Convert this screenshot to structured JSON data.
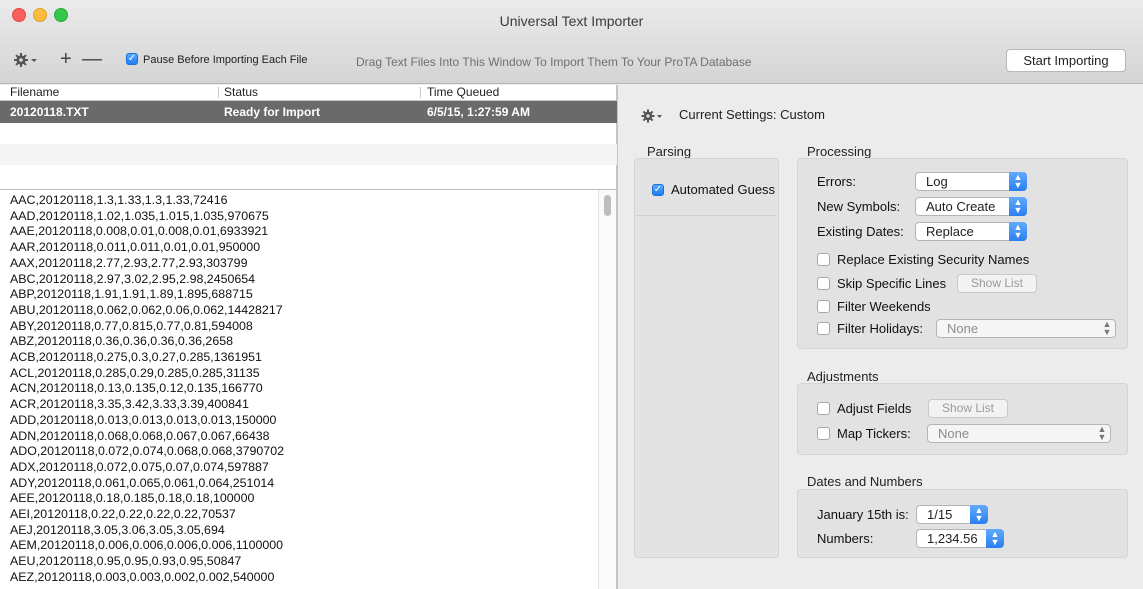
{
  "window": {
    "title": "Universal Text Importer"
  },
  "toolbar": {
    "gear_icon": "gear-icon",
    "add_label": "+",
    "remove_label": "—",
    "pause_label": "Pause Before Importing Each File",
    "pause_checked": true,
    "drag_hint": "Drag Text Files Into This Window To Import Them To Your ProTA Database",
    "start_label": "Start Importing"
  },
  "file_table": {
    "columns": [
      "Filename",
      "Status",
      "Time Queued"
    ],
    "rows": [
      {
        "filename": "20120118.TXT",
        "status": "Ready for Import",
        "time": "6/5/15, 1:27:59 AM",
        "selected": true
      }
    ]
  },
  "text_content": [
    "AAC,20120118,1.3,1.33,1.3,1.33,72416",
    "AAD,20120118,1.02,1.035,1.015,1.035,970675",
    "AAE,20120118,0.008,0.01,0.008,0.01,6933921",
    "AAR,20120118,0.011,0.011,0.01,0.01,950000",
    "AAX,20120118,2.77,2.93,2.77,2.93,303799",
    "ABC,20120118,2.97,3.02,2.95,2.98,2450654",
    "ABP,20120118,1.91,1.91,1.89,1.895,688715",
    "ABU,20120118,0.062,0.062,0.06,0.062,14428217",
    "ABY,20120118,0.77,0.815,0.77,0.81,594008",
    "ABZ,20120118,0.36,0.36,0.36,0.36,2658",
    "ACB,20120118,0.275,0.3,0.27,0.285,1361951",
    "ACL,20120118,0.285,0.29,0.285,0.285,31135",
    "ACN,20120118,0.13,0.135,0.12,0.135,166770",
    "ACR,20120118,3.35,3.42,3.33,3.39,400841",
    "ADD,20120118,0.013,0.013,0.013,0.013,150000",
    "ADN,20120118,0.068,0.068,0.067,0.067,66438",
    "ADO,20120118,0.072,0.074,0.068,0.068,3790702",
    "ADX,20120118,0.072,0.075,0.07,0.074,597887",
    "ADY,20120118,0.061,0.065,0.061,0.064,251014",
    "AEE,20120118,0.18,0.185,0.18,0.18,100000",
    "AEI,20120118,0.22,0.22,0.22,0.22,70537",
    "AEJ,20120118,3.05,3.06,3.05,3.05,694",
    "AEM,20120118,0.006,0.006,0.006,0.006,1100000",
    "AEU,20120118,0.95,0.95,0.93,0.95,50847",
    "AEZ,20120118,0.003,0.003,0.002,0.002,540000"
  ],
  "settings": {
    "current": "Current Settings: Custom",
    "parsing": {
      "title": "Parsing",
      "automated_guess": "Automated Guess",
      "automated_guess_checked": true
    },
    "processing": {
      "title": "Processing",
      "errors_label": "Errors:",
      "errors_value": "Log",
      "new_symbols_label": "New Symbols:",
      "new_symbols_value": "Auto Create",
      "existing_dates_label": "Existing Dates:",
      "existing_dates_value": "Replace",
      "replace_names": "Replace Existing Security Names",
      "skip_lines": "Skip Specific Lines",
      "skip_show_list": "Show List",
      "filter_weekends": "Filter Weekends",
      "filter_holidays": "Filter Holidays:",
      "holidays_value": "None"
    },
    "adjustments": {
      "title": "Adjustments",
      "adjust_fields": "Adjust Fields",
      "adjust_show_list": "Show List",
      "map_tickers": "Map Tickers:",
      "map_value": "None"
    },
    "dates_numbers": {
      "title": "Dates and Numbers",
      "jan15_label": "January 15th is:",
      "jan15_value": "1/15",
      "numbers_label": "Numbers:",
      "numbers_value": "1,234.56"
    }
  }
}
